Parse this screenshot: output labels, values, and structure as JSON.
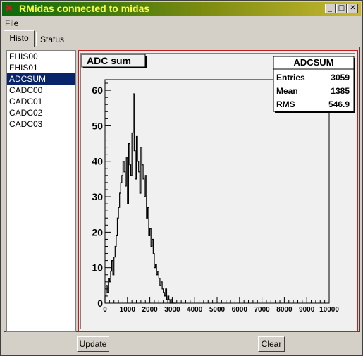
{
  "window": {
    "title": "RMidas connected to midas",
    "icon": "x-app-icon"
  },
  "window_buttons": {
    "minimize": "_",
    "maximize": "□",
    "close": "✕"
  },
  "menu": {
    "file": "File"
  },
  "tabs": [
    {
      "label": "Histo",
      "active": true
    },
    {
      "label": "Status",
      "active": false
    }
  ],
  "histogram_list": {
    "items": [
      "FHIS00",
      "FHIS01",
      "ADCSUM",
      "CADC00",
      "CADC01",
      "CADC02",
      "CADC03"
    ],
    "selected": "ADCSUM"
  },
  "buttons": {
    "update": "Update",
    "clear": "Clear"
  },
  "stats": {
    "name": "ADCSUM",
    "rows": [
      {
        "label": "Entries",
        "value": "3059"
      },
      {
        "label": "Mean",
        "value": "1385"
      },
      {
        "label": "RMS",
        "value": "546.9"
      }
    ]
  },
  "chart_data": {
    "type": "line",
    "title": "ADC sum",
    "xlabel": "",
    "ylabel": "",
    "xlim": [
      0,
      10000
    ],
    "ylim": [
      0,
      63
    ],
    "x_ticks": [
      0,
      1000,
      2000,
      3000,
      4000,
      5000,
      6000,
      7000,
      8000,
      9000,
      10000
    ],
    "x_tick_labels": [
      "0",
      "1000",
      "2000",
      "3000",
      "4000",
      "5000",
      "6000",
      "7000",
      "8000",
      "9000",
      "10000"
    ],
    "y_ticks": [
      0,
      10,
      20,
      30,
      40,
      50,
      60
    ],
    "y_tick_labels": [
      "0",
      "10",
      "20",
      "30",
      "40",
      "50",
      "60"
    ],
    "grid": false,
    "legend": "top-right",
    "bin_width": 50,
    "x": [
      0,
      50,
      100,
      150,
      200,
      250,
      300,
      350,
      400,
      450,
      500,
      550,
      600,
      650,
      700,
      750,
      800,
      850,
      900,
      950,
      1000,
      1050,
      1100,
      1150,
      1200,
      1250,
      1300,
      1350,
      1400,
      1450,
      1500,
      1550,
      1600,
      1650,
      1700,
      1750,
      1800,
      1850,
      1900,
      1950,
      2000,
      2050,
      2100,
      2150,
      2200,
      2250,
      2300,
      2350,
      2400,
      2450,
      2500,
      2550,
      2600,
      2650,
      2700,
      2750,
      2800,
      2850,
      2900,
      2950,
      3000,
      3050,
      3100
    ],
    "values": [
      2,
      5,
      3,
      7,
      6,
      9,
      12,
      8,
      13,
      16,
      19,
      24,
      27,
      31,
      34,
      36,
      40,
      37,
      33,
      41,
      28,
      45,
      39,
      36,
      48,
      59,
      43,
      35,
      47,
      40,
      37,
      31,
      44,
      39,
      35,
      30,
      36,
      24,
      27,
      19,
      21,
      16,
      18,
      14,
      10,
      11,
      8,
      9,
      7,
      5,
      6,
      4,
      3,
      2,
      4,
      1,
      2,
      1,
      0,
      1,
      0,
      0,
      0
    ]
  }
}
